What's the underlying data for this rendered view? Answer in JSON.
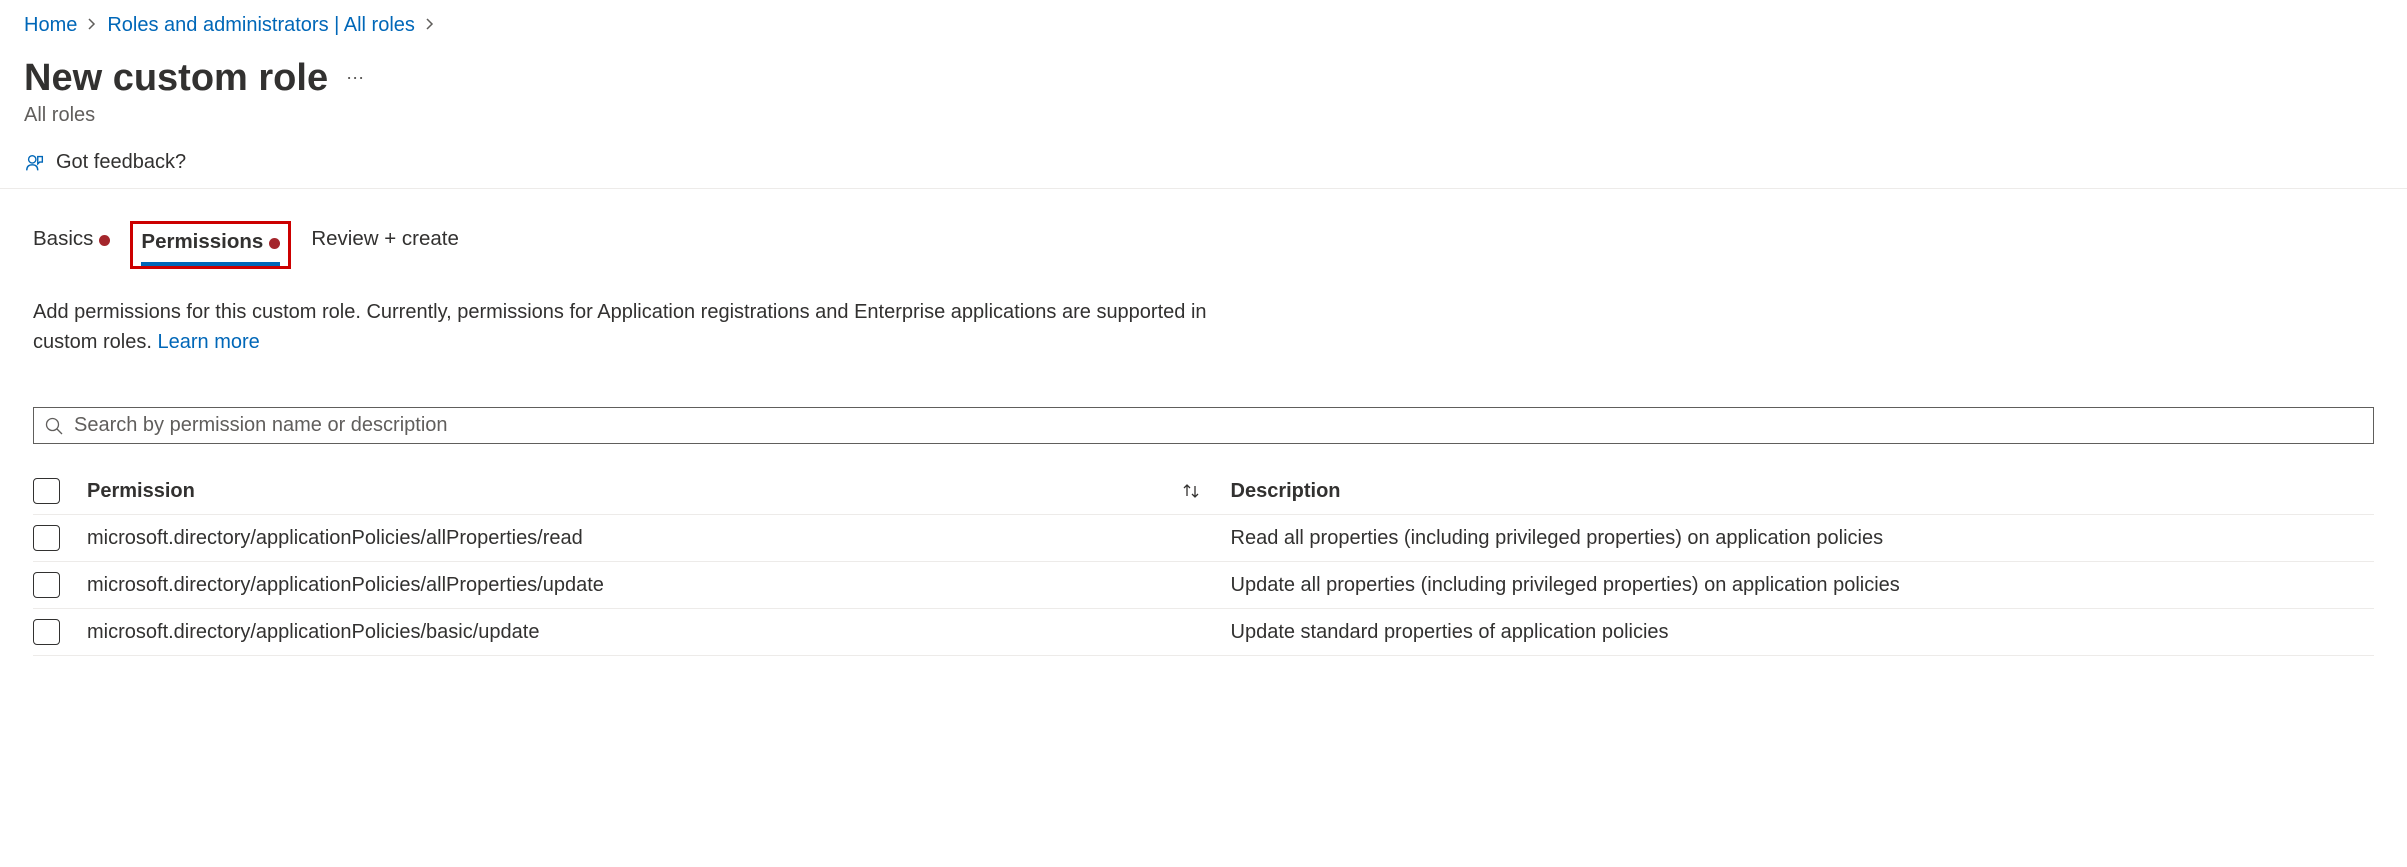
{
  "breadcrumb": {
    "items": [
      "Home",
      "Roles and administrators | All roles"
    ]
  },
  "header": {
    "title": "New custom role",
    "subtitle": "All roles"
  },
  "feedback": {
    "label": "Got feedback?"
  },
  "tabs": {
    "items": [
      {
        "label": "Basics",
        "active": false,
        "error": true
      },
      {
        "label": "Permissions",
        "active": true,
        "error": true
      },
      {
        "label": "Review + create",
        "active": false,
        "error": false
      }
    ]
  },
  "description": {
    "text": "Add permissions for this custom role. Currently, permissions for Application registrations and Enterprise applications are supported in custom roles. ",
    "link": "Learn more"
  },
  "search": {
    "placeholder": "Search by permission name or description"
  },
  "table": {
    "headers": {
      "permission": "Permission",
      "description": "Description"
    },
    "rows": [
      {
        "permission": "microsoft.directory/applicationPolicies/allProperties/read",
        "description": "Read all properties (including privileged properties) on application policies"
      },
      {
        "permission": "microsoft.directory/applicationPolicies/allProperties/update",
        "description": "Update all properties (including privileged properties) on application policies"
      },
      {
        "permission": "microsoft.directory/applicationPolicies/basic/update",
        "description": "Update standard properties of application policies"
      }
    ]
  }
}
